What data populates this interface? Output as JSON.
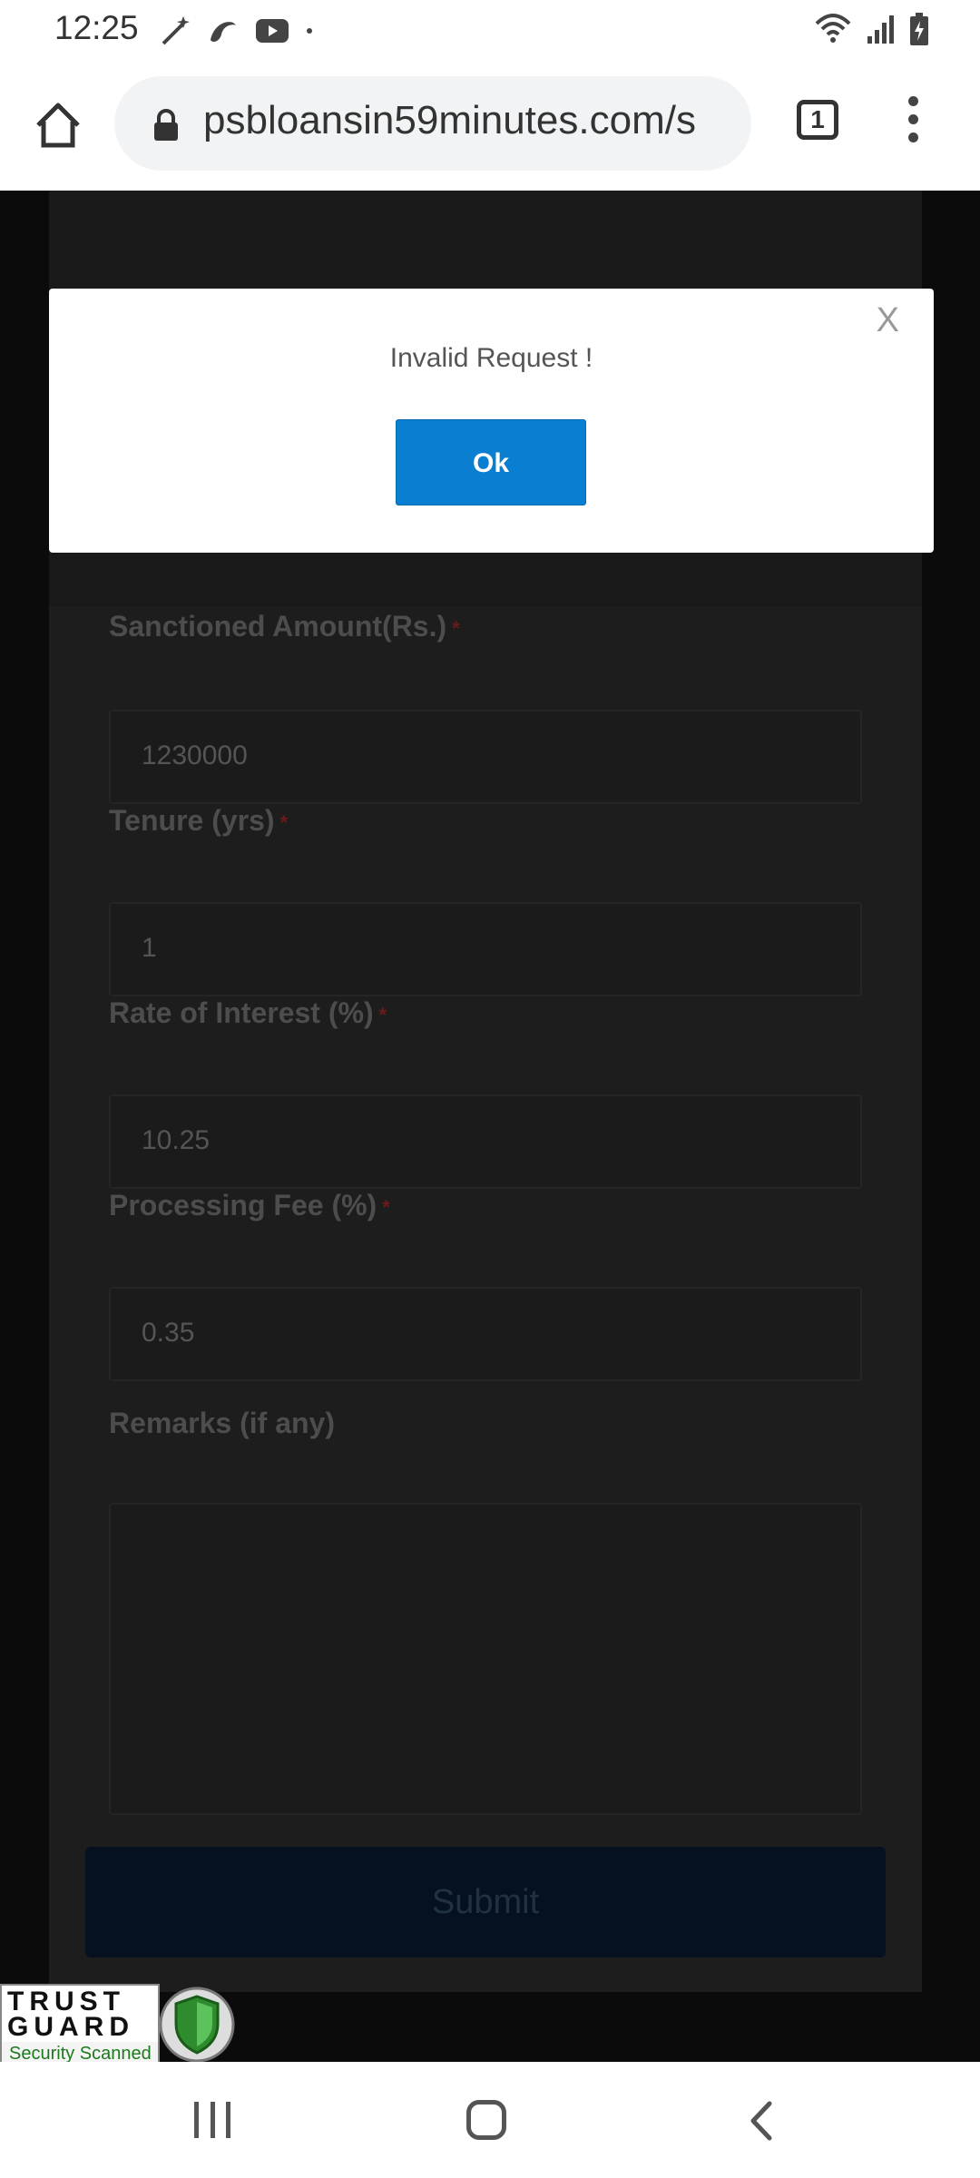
{
  "status_bar": {
    "time": "12:25"
  },
  "browser": {
    "url": "psbloansin59minutes.com/s",
    "tab_count": "1"
  },
  "form": {
    "fields": [
      {
        "label": "Sanctioned Amount(Rs.)",
        "required_mark": "*",
        "value": "1230000"
      },
      {
        "label": "Tenure (yrs)",
        "required_mark": "*",
        "value": "1"
      },
      {
        "label": "Rate of Interest (%)",
        "required_mark": "*",
        "value": "10.25"
      },
      {
        "label": "Processing Fee (%)",
        "required_mark": "*",
        "value": "0.35"
      }
    ],
    "remarks_label": "Remarks (if any)",
    "remarks_value": "",
    "submit_label": "Submit"
  },
  "trust_badge": {
    "line1": "TRUST",
    "line2": "GUARD",
    "line3": "Security Scanned"
  },
  "modal": {
    "close_label": "X",
    "message": "Invalid Request !",
    "ok_label": "Ok"
  },
  "colors": {
    "accent": "#0a7fd2",
    "overlay": "#000000"
  }
}
